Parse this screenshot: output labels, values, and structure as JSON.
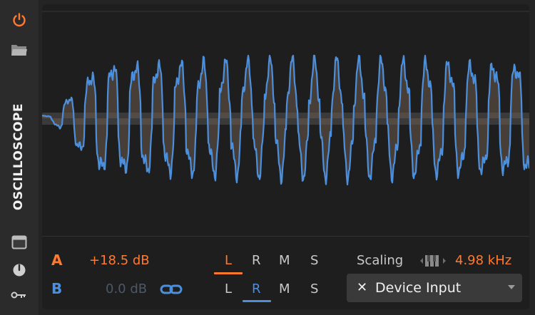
{
  "device": {
    "title": "OSCILLOSCOPE",
    "icons": [
      "power-icon",
      "folder-icon",
      "window-icon",
      "knob-icon",
      "route-icon"
    ],
    "accent_color": "#ff7a2e",
    "channel_b_color": "#4c8fdc"
  },
  "channel_a": {
    "label": "A",
    "gain": "+18.5 dB",
    "modes": [
      "L",
      "R",
      "M",
      "S"
    ],
    "selected_mode": "L"
  },
  "channel_b": {
    "label": "B",
    "gain": "0.0 dB",
    "link_icon": "link-icon",
    "modes": [
      "L",
      "R",
      "M",
      "S"
    ],
    "selected_mode": "R"
  },
  "scaling": {
    "label": "Scaling",
    "icon": "piano-keys-icon",
    "value": "4.98 kHz"
  },
  "input": {
    "label": "Device Input",
    "clear_icon": "close-icon"
  }
}
